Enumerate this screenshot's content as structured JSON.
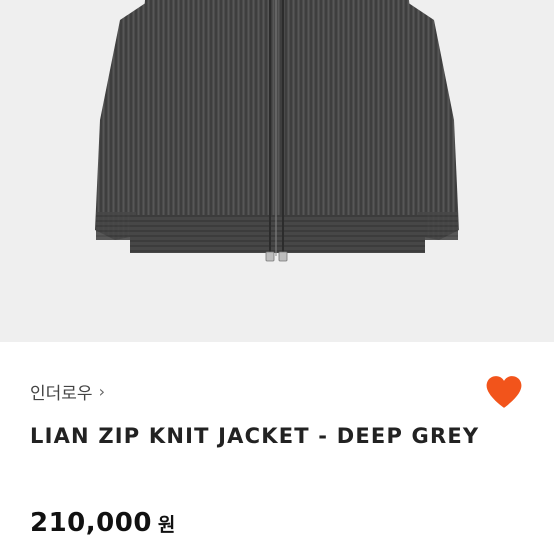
{
  "product": {
    "image_alt_icon": "knit-jacket-photo",
    "brand": "인더로우",
    "brand_chevron": "›",
    "title": "LIAN ZIP KNIT JACKET - DEEP GREY",
    "price": "210,000",
    "currency": "원",
    "favorite_icon": "heart-icon"
  },
  "colors": {
    "photo_bg": "#efefef",
    "knit": "#4a4a4a",
    "heart": "#f2541b",
    "text": "#222222"
  }
}
